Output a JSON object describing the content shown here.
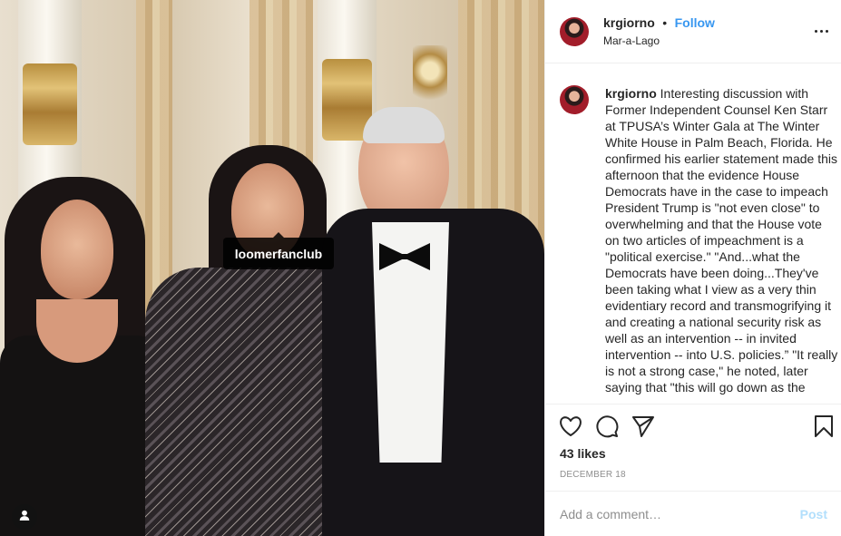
{
  "post": {
    "image_tag": "loomerfanclub"
  },
  "header": {
    "username": "krgiorno",
    "separator": "•",
    "follow_label": "Follow",
    "location": "Mar-a-Lago"
  },
  "caption": {
    "username": "krgiorno",
    "text": "Interesting discussion with Former Independent Counsel Ken Starr at TPUSA’s Winter Gala at The Winter White House in Palm Beach, Florida. He confirmed his earlier statement made this afternoon that the evidence House Democrats have in the case to impeach President Trump is \"not even close\" to overwhelming and that the House vote on two articles of impeachment is a \"political exercise.\" \"And...what the Democrats have been doing...They've been taking what I view as a very thin evidentiary record and transmogrifying it and creating a national security risk as well as an intervention -- in invited intervention -- into U.S. policies.” \"It really is not a strong case,\" he noted, later saying that \"this will go down as the"
  },
  "actions": {
    "likes": "43 likes",
    "date": "DECEMBER 18"
  },
  "comment": {
    "placeholder": "Add a comment…",
    "post_label": "Post"
  },
  "colors": {
    "accent": "#3897f0",
    "post_disabled": "#b2dffc",
    "text": "#262626",
    "muted": "#8e8e8e",
    "border": "#efefef"
  },
  "icons": [
    "heart-icon",
    "comment-icon",
    "share-icon",
    "bookmark-icon",
    "more-options-icon",
    "user-tag-icon"
  ]
}
